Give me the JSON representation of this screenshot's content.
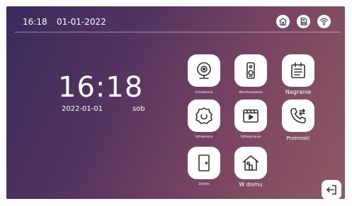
{
  "status_bar": {
    "time": "16:18",
    "date": "01-01-2022",
    "icons": [
      "home-icon",
      "sd-card-icon",
      "wifi-icon"
    ]
  },
  "clock": {
    "time": "16:18",
    "date": "2022-01-01",
    "day": "sob"
  },
  "tiles": [
    {
      "icon": "camera-icon",
      "label": "Urządzenia"
    },
    {
      "icon": "doorbell-icon",
      "label": "Monitorowanie"
    },
    {
      "icon": "calendar-icon",
      "label": "Nagranie"
    },
    {
      "icon": "settings-icon",
      "label": "Ustawienia"
    },
    {
      "icon": "playback-icon",
      "label": "Odtwarzanie"
    },
    {
      "icon": "call-transfer-icon",
      "label": "Przenosić"
    },
    {
      "icon": "door-icon",
      "label": "Zamek"
    },
    {
      "icon": "home-icon",
      "label": "W domu"
    }
  ],
  "colors": {
    "background_start": "#3a2b5f",
    "background_end": "#8e5a64",
    "tile": "#ffffff",
    "icon": "#333333"
  },
  "exit_icon": "exit-icon"
}
